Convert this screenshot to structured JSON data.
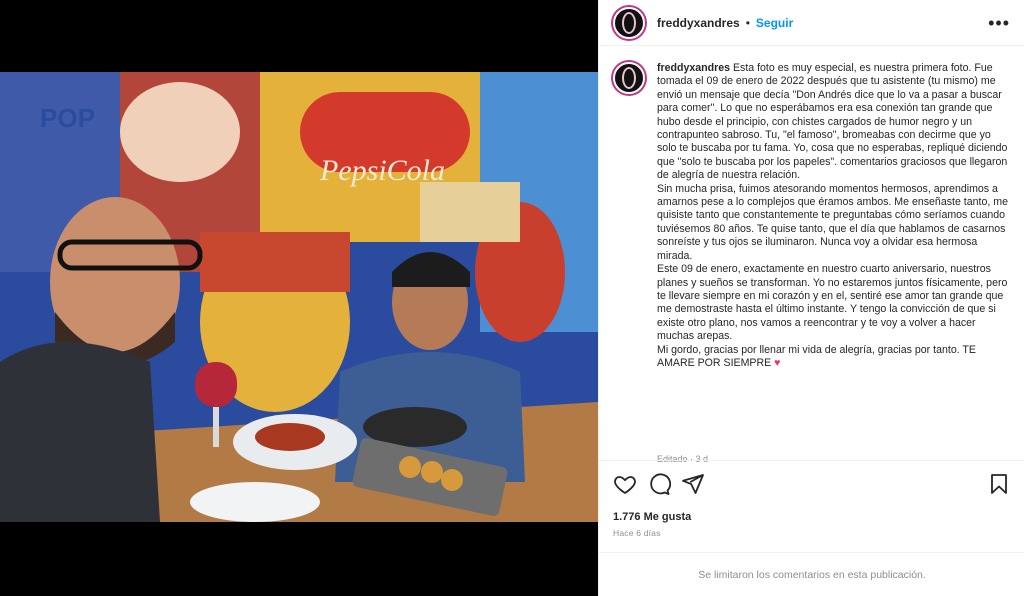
{
  "post": {
    "username": "freddyxandres",
    "follow_label": "Seguir",
    "separator": "•",
    "more_label": "•••"
  },
  "caption": {
    "username": "freddyxandres",
    "text": " Esta foto es muy especial, es nuestra primera foto. Fue tomada el 09 de enero de 2022 después que tu asistente (tu mismo) me envió un mensaje que decía \"Don Andrés dice que lo va a pasar a buscar para comer\". Lo que no esperábamos era esa conexión tan grande que hubo desde el principio, con chistes cargados de humor negro y un contrapunteo sabroso. Tu, \"el famoso\", bromeabas con decirme que yo solo te buscaba por tu fama. Yo, cosa que no esperabas, repliqué diciendo que \"solo te buscaba por los papeles\". comentarios graciosos que llegaron de alegría de nuestra relación.\nSin mucha prisa, fuimos atesorando momentos hermosos, aprendimos a amarnos pese a lo complejos que éramos ambos. Me enseñaste tanto, me quisiste tanto que constantemente te preguntabas cómo seríamos cuando tuviésemos 80 años. Te quise tanto, que el día que hablamos de casarnos sonreíste y tus ojos se iluminaron. Nunca voy a olvidar esa hermosa mirada.\nEste 09 de enero, exactamente en nuestro cuarto aniversario, nuestros planes y sueños se transforman. Yo no estaremos juntos físicamente, pero te llevare siempre en mi corazón y en el, sentiré ese amor tan grande que me demostraste hasta el último instante. Y tengo la convicción de que si existe otro plano, nos vamos a reencontrar y te voy a volver a hacer muchas arepas.\nMi gordo, gracias por llenar mi vida de alegría, gracias por tanto. TE AMARE POR SIEMPRE ",
    "heart": "♥",
    "edited": "Editado · 3 d"
  },
  "actions": {
    "likes": "1.776 Me gusta",
    "date": "Hace 6 días",
    "icons": [
      "heart-icon",
      "comment-icon",
      "share-icon",
      "bookmark-icon"
    ]
  },
  "comments": {
    "limited_text": "Se limitaron los comentarios en esta publicación."
  },
  "colors": {
    "link": "#0095f6",
    "text": "#262626",
    "muted": "#8e8e8e",
    "heart": "#e8336f"
  }
}
